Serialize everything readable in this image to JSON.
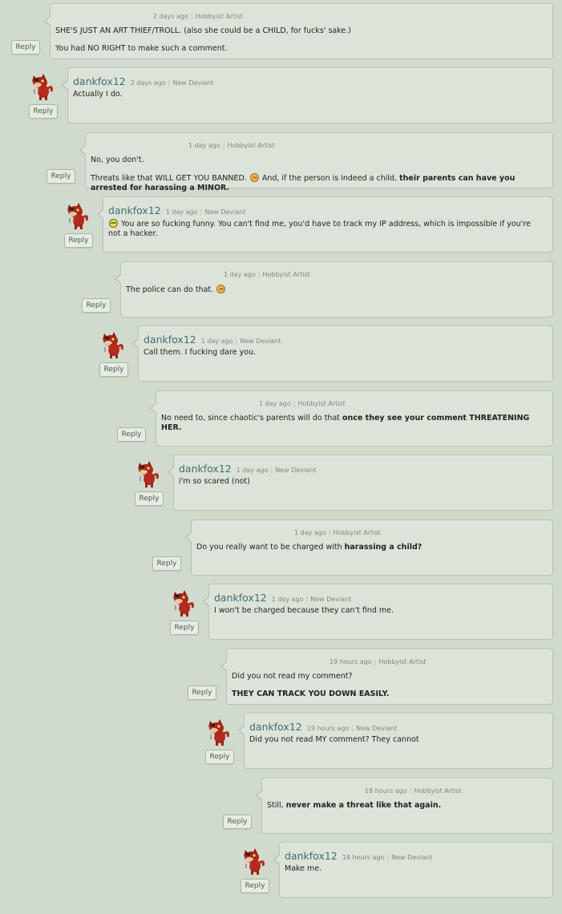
{
  "reply_label": "Reply",
  "comments": [
    {
      "user": "",
      "time": "2 days ago",
      "role": "Hobbyist Artist",
      "paragraphs": [
        [
          {
            "t": "SHE'S JUST AN ART THIEF/TROLL. (also she could be a CHILD, for fucks' sake.)"
          }
        ],
        [
          {
            "t": "You had NO RIGHT to make such a comment."
          }
        ]
      ]
    },
    {
      "user": "dankfox12",
      "time": "2 days ago",
      "role": "New Deviant",
      "paragraphs": [
        [
          {
            "t": "Actually I do."
          }
        ]
      ]
    },
    {
      "user": "",
      "time": "1 day ago",
      "role": "Hobbyist Artist",
      "paragraphs": [
        [
          {
            "t": "No, you don't."
          }
        ],
        [
          {
            "t": "Threats like that WILL GET YOU BANNED. "
          },
          {
            "emote": "facepalm"
          },
          {
            "t": " And, if the person is indeed a child, "
          },
          {
            "t": "their parents can have you arrested for harassing a MINOR.",
            "b": true
          }
        ]
      ]
    },
    {
      "user": "dankfox12",
      "time": "1 day ago",
      "role": "New Deviant",
      "paragraphs": [
        [
          {
            "emote": "smug"
          },
          {
            "t": " You are so fucking funny. You can't find me, you'd have to track my IP address, which is impossible if you're not a hacker."
          }
        ]
      ]
    },
    {
      "user": "",
      "time": "1 day ago",
      "role": "Hobbyist Artist",
      "paragraphs": [
        [
          {
            "t": "The police can do that. "
          },
          {
            "emote": "facepalm"
          }
        ]
      ]
    },
    {
      "user": "dankfox12",
      "time": "1 day ago",
      "role": "New Deviant",
      "paragraphs": [
        [
          {
            "t": "Call them. I fucking dare you."
          }
        ]
      ]
    },
    {
      "user": "",
      "time": "1 day ago",
      "role": "Hobbyist Artist",
      "paragraphs": [
        [
          {
            "t": "No need to, since chaotic's parents will do that "
          },
          {
            "t": "once they see your comment THREATENING HER.",
            "b": true
          }
        ]
      ]
    },
    {
      "user": "dankfox12",
      "time": "1 day ago",
      "role": "New Deviant",
      "paragraphs": [
        [
          {
            "t": "i'm so scared (not)"
          }
        ]
      ]
    },
    {
      "user": "",
      "time": "1 day ago",
      "role": "Hobbyist Artist",
      "paragraphs": [
        [
          {
            "t": "Do you really want to be charged with "
          },
          {
            "t": "harassing a child?",
            "b": true
          }
        ]
      ]
    },
    {
      "user": "dankfox12",
      "time": "1 day ago",
      "role": "New Deviant",
      "paragraphs": [
        [
          {
            "t": "I won't be charged because they can't find me."
          }
        ]
      ]
    },
    {
      "user": "",
      "time": "19 hours ago",
      "role": "Hobbyist Artist",
      "paragraphs": [
        [
          {
            "t": "Did you not read my comment?"
          }
        ],
        [
          {
            "t": "THEY CAN TRACK YOU DOWN EASILY.",
            "b": true
          }
        ]
      ]
    },
    {
      "user": "dankfox12",
      "time": "19 hours ago",
      "role": "New Deviant",
      "paragraphs": [
        [
          {
            "t": "Did you not read MY comment? They cannot"
          }
        ]
      ]
    },
    {
      "user": "",
      "time": "18 hours ago",
      "role": "Hobbyist Artist",
      "paragraphs": [
        [
          {
            "t": "Still, "
          },
          {
            "t": "never make a threat like that again.",
            "b": true
          }
        ]
      ]
    },
    {
      "user": "dankfox12",
      "time": "18 hours ago",
      "role": "New Deviant",
      "paragraphs": [
        [
          {
            "t": "Make me."
          }
        ]
      ]
    }
  ]
}
